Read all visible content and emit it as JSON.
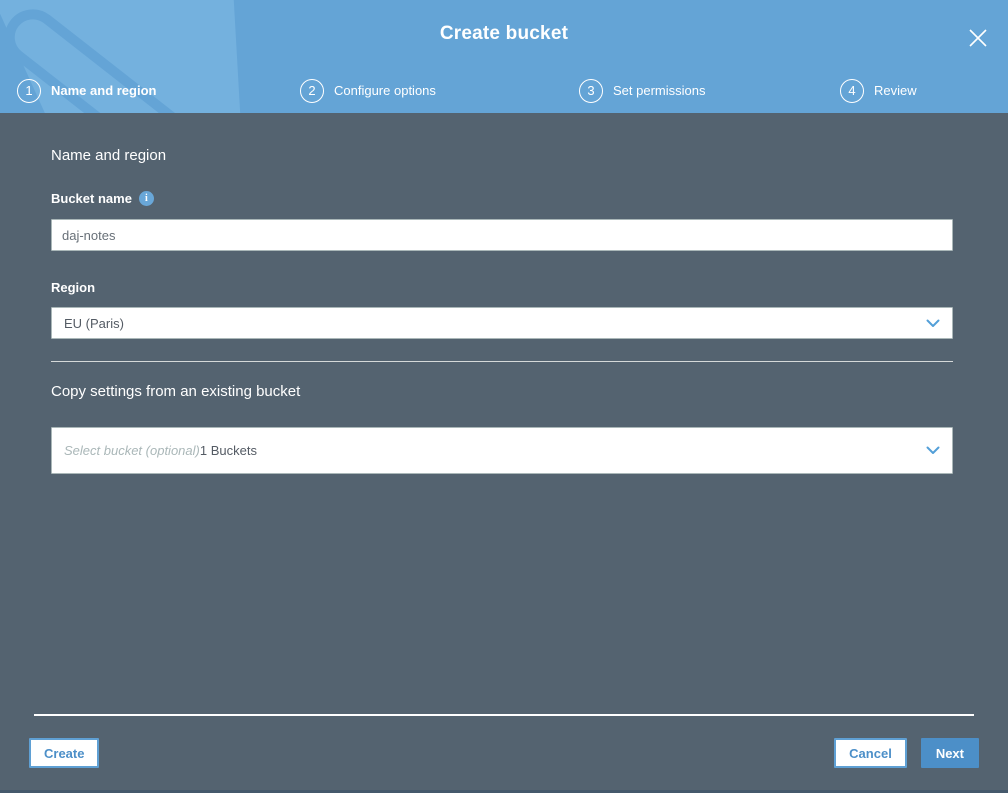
{
  "modal": {
    "title": "Create bucket"
  },
  "stepper": {
    "steps": [
      {
        "number": "1",
        "label": "Name and region"
      },
      {
        "number": "2",
        "label": "Configure options"
      },
      {
        "number": "3",
        "label": "Set permissions"
      },
      {
        "number": "4",
        "label": "Review"
      }
    ]
  },
  "form": {
    "section_title": "Name and region",
    "bucket_name_label": "Bucket name",
    "bucket_name_value": "daj-notes",
    "info_icon_glyph": "i",
    "region_label": "Region",
    "region_value": "EU (Paris)",
    "copy_title": "Copy settings from an existing bucket",
    "bucket_select_placeholder": "Select bucket (optional)",
    "bucket_select_count": "1 Buckets"
  },
  "footer": {
    "create": "Create",
    "cancel": "Cancel",
    "next": "Next"
  },
  "colors": {
    "header_blue": "#64a4d6",
    "body_slate": "#546370",
    "accent_blue": "#4c8fc8",
    "input_border": "#aab7b8"
  }
}
